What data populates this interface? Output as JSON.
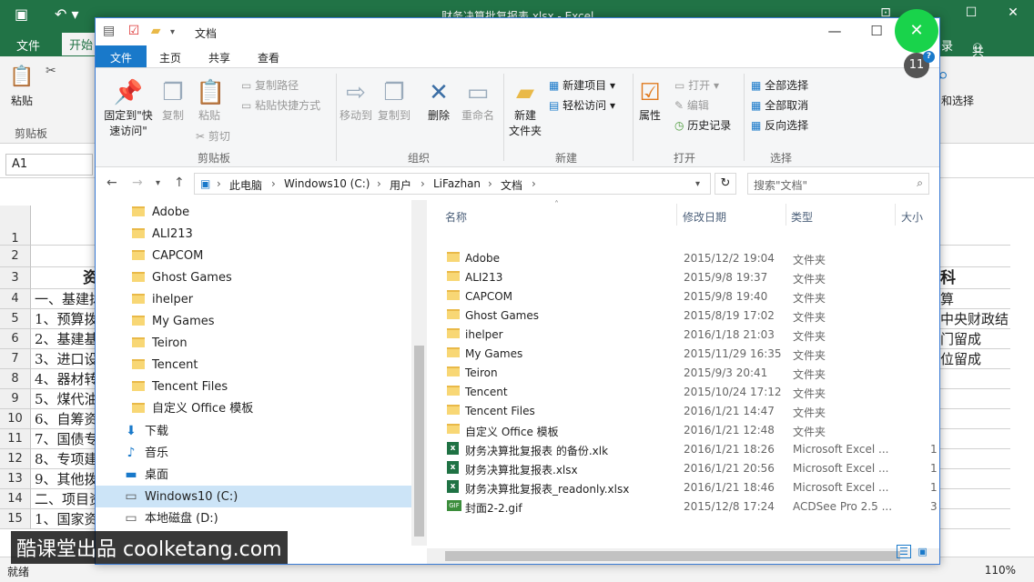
{
  "excel": {
    "doc_title": "财务决算批复报表.xlsx - Excel",
    "tabs": [
      "文件",
      "开始"
    ],
    "right_tabs": [
      "录",
      "共享"
    ],
    "ribbon_group": "剪贴板",
    "ribbon_paste": "粘贴",
    "ribbon_select": "和选择",
    "namebox": "A1",
    "row_numbers": [
      "1",
      "2",
      "3",
      "4",
      "5",
      "6",
      "7",
      "8",
      "9",
      "10",
      "11",
      "12",
      "13",
      "14",
      "15"
    ],
    "col_a": [
      "",
      "",
      "资",
      "一、基建拨",
      "1、预算拨",
      "2、基建基",
      "3、进口设",
      "4、器材转",
      "5、煤代油",
      "6、自筹资",
      "7、国债专",
      "8、专项建",
      "9、其他拨",
      "二、项目资",
      "1、国家资"
    ],
    "col_right": [
      "",
      "",
      "科",
      "算",
      "中央财政结",
      "门留成",
      "位留成",
      "",
      "",
      "",
      "",
      "",
      "",
      "",
      ""
    ],
    "status_ready": "就绪",
    "zoom": "110%"
  },
  "explorer": {
    "title": "文档",
    "tabs": [
      "文件",
      "主页",
      "共享",
      "查看"
    ],
    "ribbon": {
      "pin": "固定到\"快速访问\"",
      "copy": "复制",
      "paste": "粘贴",
      "copy_path": "复制路径",
      "paste_shortcut": "粘贴快捷方式",
      "cut": "剪切",
      "group_clipboard": "剪贴板",
      "move_to": "移动到",
      "copy_to": "复制到",
      "delete": "删除",
      "rename": "重命名",
      "group_organize": "组织",
      "new_folder": "新建\n文件夹",
      "new_item": "新建项目",
      "easy_access": "轻松访问",
      "group_new": "新建",
      "properties": "属性",
      "open": "打开",
      "edit": "编辑",
      "history": "历史记录",
      "group_open": "打开",
      "select_all": "全部选择",
      "select_none": "全部取消",
      "invert": "反向选择",
      "group_select": "选择"
    },
    "breadcrumb": [
      "此电脑",
      "Windows10 (C:)",
      "用户",
      "LiFazhan",
      "文档"
    ],
    "search_placeholder": "搜索\"文档\"",
    "nav_folders": [
      "Adobe",
      "ALI213",
      "CAPCOM",
      "Ghost Games",
      "ihelper",
      "My Games",
      "Teiron",
      "Tencent",
      "Tencent Files",
      "自定义 Office 模板"
    ],
    "nav_other": [
      {
        "label": "下载",
        "icon": "download-icon"
      },
      {
        "label": "音乐",
        "icon": "music-icon"
      },
      {
        "label": "桌面",
        "icon": "desktop-icon"
      },
      {
        "label": "Windows10 (C:)",
        "icon": "drive-icon"
      },
      {
        "label": "本地磁盘 (D:)",
        "icon": "drive-icon"
      }
    ],
    "columns": {
      "name": "名称",
      "date": "修改日期",
      "type": "类型",
      "size": "大小"
    },
    "files": [
      {
        "name": "Adobe",
        "date": "2015/12/2 19:04",
        "type": "文件夹",
        "size": "",
        "kind": "folder"
      },
      {
        "name": "ALI213",
        "date": "2015/9/8 19:37",
        "type": "文件夹",
        "size": "",
        "kind": "folder"
      },
      {
        "name": "CAPCOM",
        "date": "2015/9/8 19:40",
        "type": "文件夹",
        "size": "",
        "kind": "folder"
      },
      {
        "name": "Ghost Games",
        "date": "2015/8/19 17:02",
        "type": "文件夹",
        "size": "",
        "kind": "folder"
      },
      {
        "name": "ihelper",
        "date": "2016/1/18 21:03",
        "type": "文件夹",
        "size": "",
        "kind": "folder"
      },
      {
        "name": "My Games",
        "date": "2015/11/29 16:35",
        "type": "文件夹",
        "size": "",
        "kind": "folder"
      },
      {
        "name": "Teiron",
        "date": "2015/9/3 20:41",
        "type": "文件夹",
        "size": "",
        "kind": "folder"
      },
      {
        "name": "Tencent",
        "date": "2015/10/24 17:12",
        "type": "文件夹",
        "size": "",
        "kind": "folder"
      },
      {
        "name": "Tencent Files",
        "date": "2016/1/21 14:47",
        "type": "文件夹",
        "size": "",
        "kind": "folder"
      },
      {
        "name": "自定义 Office 模板",
        "date": "2016/1/21 12:48",
        "type": "文件夹",
        "size": "",
        "kind": "folder"
      },
      {
        "name": "财务决算批复报表 的备份.xlk",
        "date": "2016/1/21 18:26",
        "type": "Microsoft Excel ...",
        "size": "1",
        "kind": "excel"
      },
      {
        "name": "财务决算批复报表.xlsx",
        "date": "2016/1/21 20:56",
        "type": "Microsoft Excel ...",
        "size": "1",
        "kind": "excel"
      },
      {
        "name": "财务决算批复报表_readonly.xlsx",
        "date": "2016/1/21 18:46",
        "type": "Microsoft Excel ...",
        "size": "1",
        "kind": "excel"
      },
      {
        "name": "封面2-2.gif",
        "date": "2015/12/8 17:24",
        "type": "ACDSee Pro 2.5 ...",
        "size": "3",
        "kind": "gif"
      }
    ]
  },
  "overlay": {
    "step_number": "11",
    "watermark": "酷课堂出品 coolketang.com"
  },
  "colors": {
    "excel_green": "#217346",
    "explorer_blue": "#1979ca",
    "highlight_green": "#19d34b"
  }
}
